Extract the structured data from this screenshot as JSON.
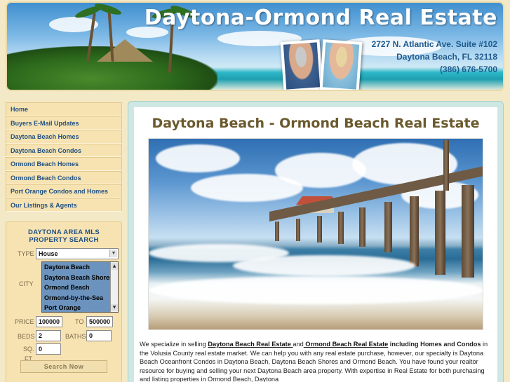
{
  "header": {
    "site_title": "Daytona-Ormond Real Estate",
    "address_line1": "2727 N. Atlantic Ave. Suite #102",
    "address_line2": "Daytona Beach, FL 32118",
    "phone": "(386) 676-5700"
  },
  "nav": {
    "items": [
      {
        "label": "Home"
      },
      {
        "label": "Buyers E-Mail Updates"
      },
      {
        "label": "Daytona Beach Homes"
      },
      {
        "label": "Daytona Beach Condos"
      },
      {
        "label": "Ormond Beach Homes"
      },
      {
        "label": "Ormond Beach Condos"
      },
      {
        "label": "Port Orange Condos and Homes"
      },
      {
        "label": "Our Listings & Agents"
      }
    ]
  },
  "mls_search": {
    "title_line1": "DAYTONA AREA MLS",
    "title_line2": "PROPERTY SEARCH",
    "type_label": "TYPE",
    "type_value": "House",
    "city_label": "CITY",
    "cities": [
      "Daytona Beach",
      "Daytona Beach Shores",
      "Ormond Beach",
      "Ormond-by-the-Sea",
      "Port Orange"
    ],
    "price_label": "PRICE",
    "price_min": "100000",
    "to_label": "TO",
    "price_max": "500000",
    "beds_label": "BEDS",
    "beds_value": "2",
    "baths_label": "BATHS",
    "baths_value": "0",
    "sqft_label_1": "SQ.",
    "sqft_label_2": "FT.",
    "sqft_value": "0",
    "search_button": "Search Now"
  },
  "main": {
    "page_title": "Daytona Beach - Ormond Beach Real Estate",
    "intro": {
      "t1": "We specialize in selling ",
      "link1": "Daytona Beach Real Estate ",
      "t2": "and",
      "link2": " Ormond Beach Real Estate",
      "b1": " including Homes and Condos",
      "t3": " in the Volusia County real estate market. We can help you with any real estate purchase, however, our specialty is Daytona Beach Oceanfront Condos in Daytona Beach, Daytona Beach Shores and Ormond Beach. You have found your realtor resource for buying and selling your next Daytona Beach area property. With expertise in Real Estate for both purchasing and listing properties in Ormond Beach, Daytona"
    }
  },
  "colors": {
    "page_bg": "#f3e9c6",
    "nav_bg": "#f7e3b2",
    "nav_text": "#1e4f82",
    "title_brown": "#6b5a2e",
    "main_frame": "#cfe7e3"
  }
}
